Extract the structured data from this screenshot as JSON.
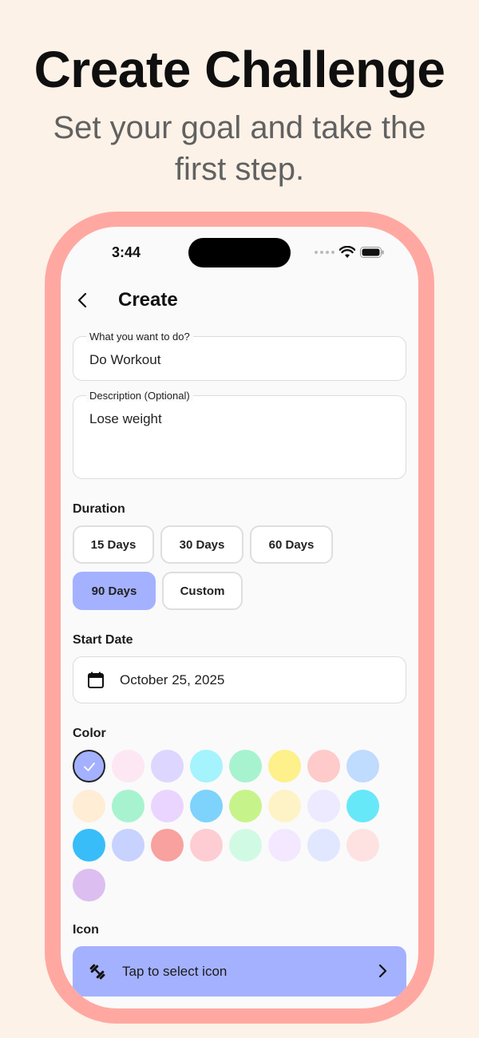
{
  "promo": {
    "headline": "Create Challenge",
    "subhead": "Set your goal and take the first step."
  },
  "status_bar": {
    "time": "3:44"
  },
  "header": {
    "title": "Create"
  },
  "form": {
    "activity": {
      "label": "What you want to do?",
      "value": "Do Workout"
    },
    "description": {
      "label": "Description (Optional)",
      "value": "Lose weight"
    }
  },
  "duration": {
    "label": "Duration",
    "options": [
      "15 Days",
      "30 Days",
      "60 Days",
      "90 Days",
      "Custom"
    ],
    "selected": "90 Days"
  },
  "start_date": {
    "label": "Start Date",
    "value": "October 25, 2025"
  },
  "color": {
    "label": "Color",
    "swatches": [
      "#a4b1ff",
      "#fce7f3",
      "#ddd6fe",
      "#a5f3fc",
      "#a7f3d0",
      "#fef08a",
      "#fecaca",
      "#bfdbfe",
      "#ffedd5",
      "#a7f3d0",
      "#e9d5ff",
      "#7dd3fc",
      "#c6f48a",
      "#fef3c7",
      "#ede9fe",
      "#67e8f9",
      "#38bdf8",
      "#c7d2fe",
      "#f8a19f",
      "#fecdd3",
      "#d1fae5",
      "#f3e8ff",
      "#e0e7ff",
      "#fee2e2",
      "#dcbff0"
    ],
    "selected_index": 0
  },
  "icon": {
    "label": "Icon",
    "button_label": "Tap to select icon"
  },
  "colors": {
    "accent": "#a4b1ff",
    "frame": "#ffa8a2",
    "background": "#fdf2e8"
  }
}
